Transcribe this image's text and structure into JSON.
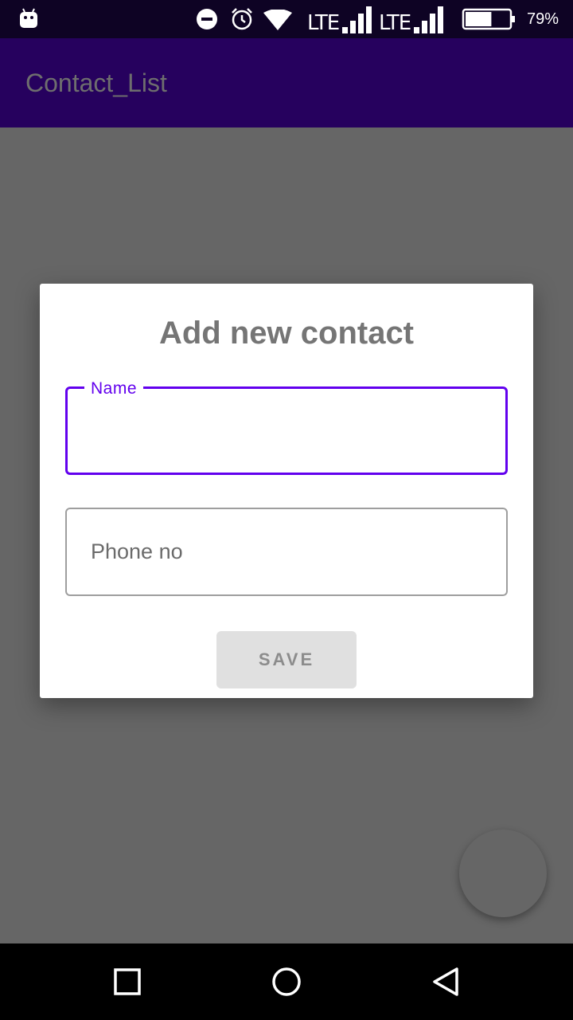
{
  "status_bar": {
    "notification_icon": "android-robot-icon",
    "icons": [
      "do-not-disturb-icon",
      "alarm-clock-icon",
      "wifi-icon"
    ],
    "network_1": "LTE",
    "network_2": "LTE",
    "battery_level": 0.6,
    "battery_text": "79%"
  },
  "app_bar": {
    "title": "Contact_List",
    "background_color": "#26015e"
  },
  "dialog": {
    "title": "Add new contact",
    "name_field": {
      "label": "Name",
      "value": "",
      "state": "focused",
      "accent_color": "#6200ee"
    },
    "phone_field": {
      "placeholder": "Phone no",
      "value": ""
    },
    "save_button": {
      "label": "SAVE",
      "state": "disabled"
    }
  },
  "fab": {
    "state": "dimmed"
  },
  "nav_bar": {
    "buttons": [
      "recents-icon",
      "home-icon",
      "back-icon"
    ]
  }
}
